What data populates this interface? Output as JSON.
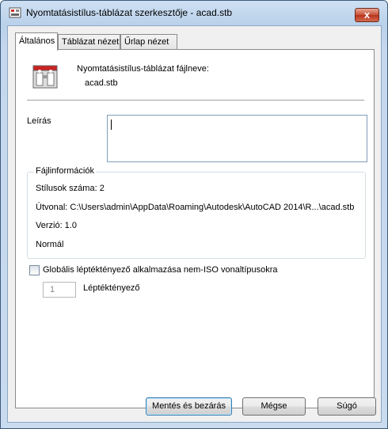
{
  "window": {
    "title": "Nyomtatásistílus-táblázat szerkesztője - acad.stb",
    "close_glyph": "x"
  },
  "tabs": [
    {
      "label": "Általános",
      "active": true
    },
    {
      "label": "Táblázat nézet",
      "active": false
    },
    {
      "label": "Űrlap nézet",
      "active": false
    }
  ],
  "general": {
    "icon": "print-style-table-icon",
    "filename_label": "Nyomtatásistílus-táblázat fájlneve:",
    "filename_value": "acad.stb",
    "description_label": "Leírás",
    "description_value": ""
  },
  "file_info": {
    "title": "Fájlinformációk",
    "styles_count": "Stílusok száma: 2",
    "path": "Útvonal: C:\\Users\\admin\\AppData\\Roaming\\Autodesk\\AutoCAD 2014\\R...\\acad.stb",
    "version": "Verzió: 1.0",
    "type": "Normál"
  },
  "scale": {
    "checkbox_label": "Globális léptéktényező alkalmazása nem-ISO vonaltípusokra",
    "checked": false,
    "value": "1",
    "label": "Léptéktényező"
  },
  "buttons": {
    "save_close": "Mentés és bezárás",
    "cancel": "Mégse",
    "help": "Súgó"
  },
  "colors": {
    "close_button": "#c75037",
    "default_button_border": "#3c7fb1"
  }
}
